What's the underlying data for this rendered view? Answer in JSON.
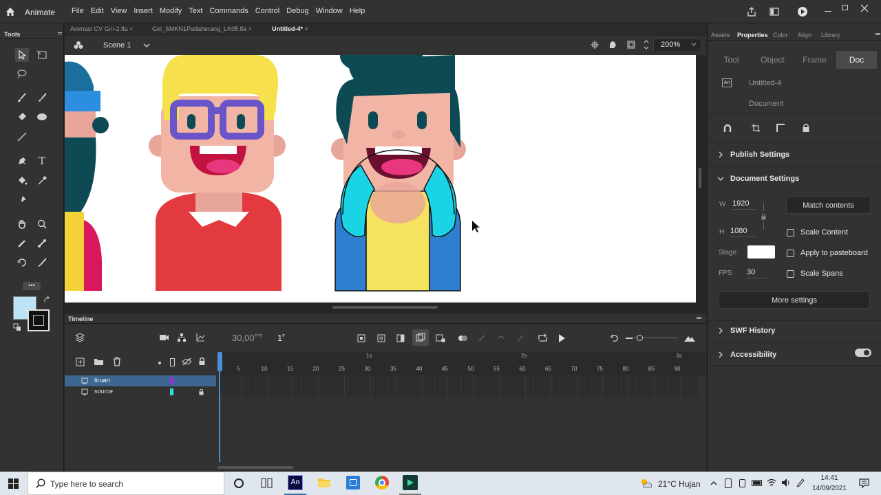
{
  "app": {
    "name": "Animate"
  },
  "menu": [
    "File",
    "Edit",
    "View",
    "Insert",
    "Modify",
    "Text",
    "Commands",
    "Control",
    "Debug",
    "Window",
    "Help"
  ],
  "tools_title": "Tools",
  "doc_tabs": [
    {
      "label": "Animasi CV Giri-2.fla",
      "active": false
    },
    {
      "label": "Giri_SMKN1Padaherang_LK05.fla",
      "active": false
    },
    {
      "label": "Untitled-4*",
      "active": true
    }
  ],
  "scene": {
    "label": "Scene 1",
    "zoom": "200%"
  },
  "timeline": {
    "title": "Timeline",
    "fps": "30,00",
    "fps_unit": "FPS",
    "frame": "1",
    "frame_unit": "F",
    "seconds": [
      "1s",
      "2s",
      "3s"
    ],
    "frame_numbers": [
      "5",
      "10",
      "15",
      "20",
      "25",
      "30",
      "35",
      "40",
      "45",
      "50",
      "55",
      "60",
      "65",
      "70",
      "75",
      "80",
      "85",
      "90"
    ],
    "layers": [
      {
        "name": "tiruan",
        "selected": true,
        "color": "#9b30d9",
        "locked": false
      },
      {
        "name": "source",
        "selected": false,
        "color": "#30e0e0",
        "locked": true
      }
    ]
  },
  "properties": {
    "panel_tabs": [
      "Assets",
      "Properties",
      "Color",
      "Align",
      "Library"
    ],
    "active_panel_tab": "Properties",
    "sub_tabs": [
      "Tool",
      "Object",
      "Frame",
      "Doc"
    ],
    "active_sub_tab": "Doc",
    "doc_name": "Untitled-4",
    "doc_type": "Document",
    "publish_settings": "Publish Settings",
    "document_settings": "Document Settings",
    "w_label": "W",
    "w_value": "1920",
    "h_label": "H",
    "h_value": "1080",
    "match_contents": "Match contents",
    "scale_content": "Scale Content",
    "stage_label": "Stage",
    "stage_color": "#ffffff",
    "apply_pasteboard": "Apply to pasteboard",
    "fps_label": "FPS",
    "fps_value": "30",
    "scale_spans": "Scale Spans",
    "more_settings": "More settings",
    "swf_history": "SWF History",
    "accessibility": "Accessibility"
  },
  "taskbar": {
    "search_placeholder": "Type here to search",
    "weather": "21°C  Hujan",
    "time": "14:41",
    "date": "14/09/2021"
  },
  "colors": {
    "accent": "#3a6fa8",
    "layer_selected": "#3d6690",
    "playhead": "#4a90d9"
  }
}
